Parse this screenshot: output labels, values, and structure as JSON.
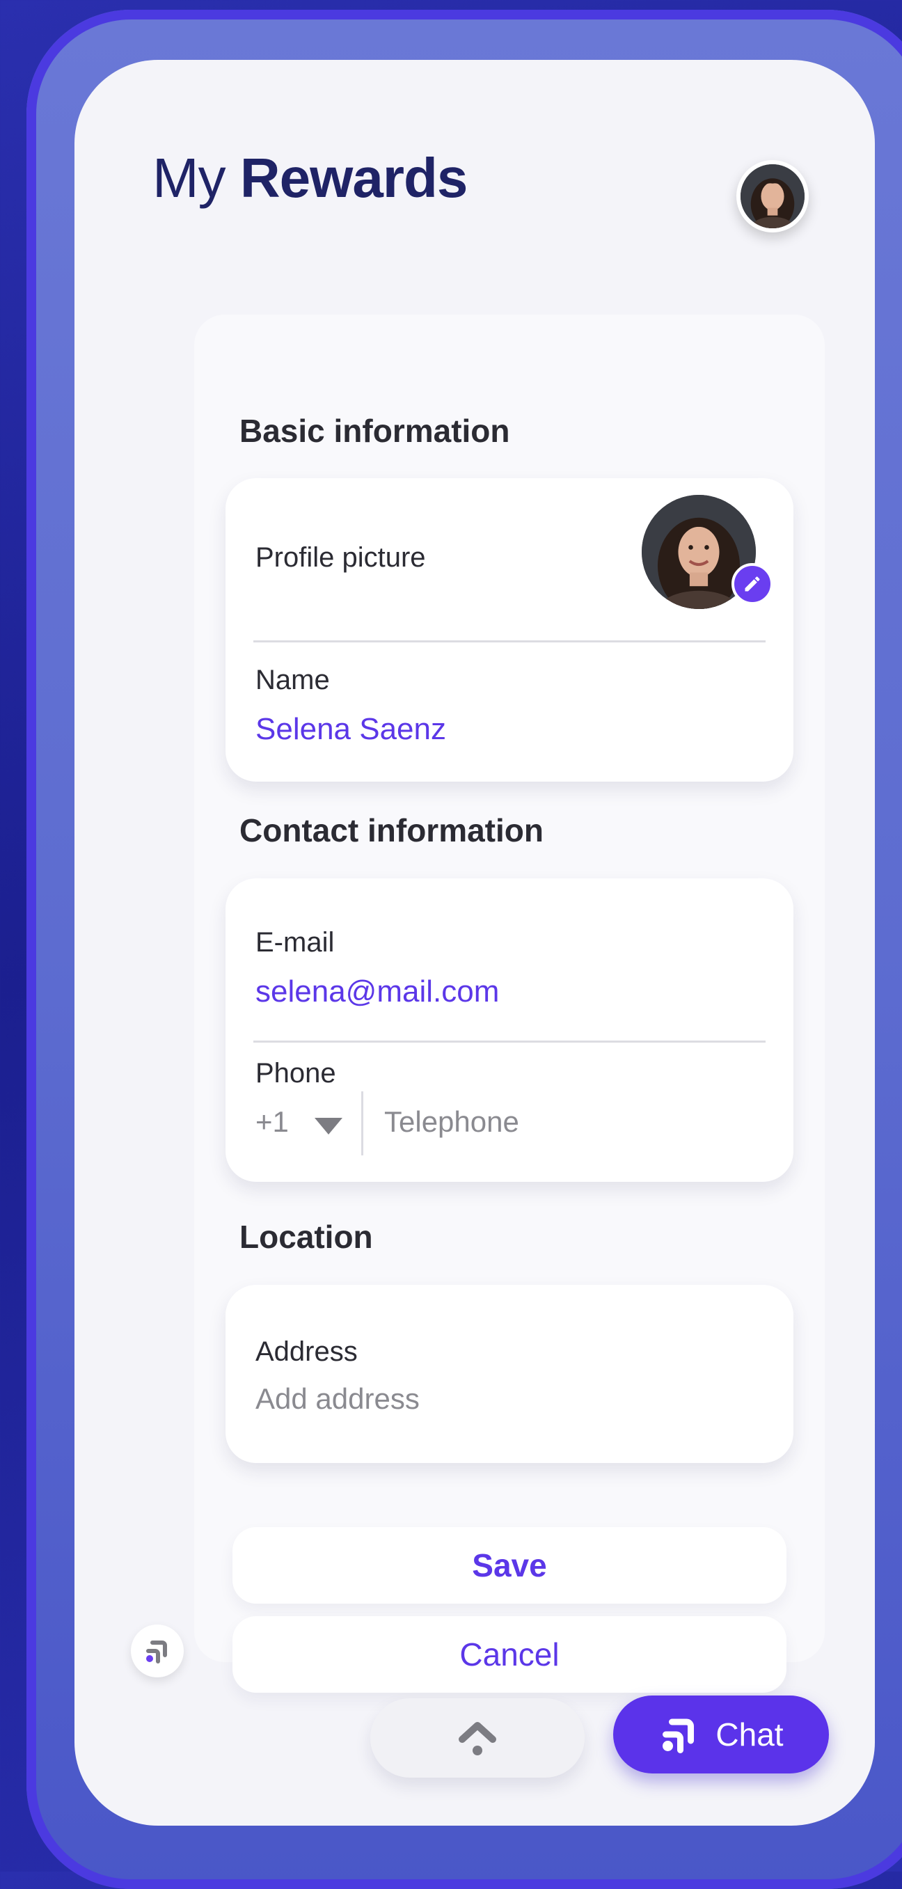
{
  "header": {
    "title_light": "My",
    "title_bold": "Rewards"
  },
  "sections": {
    "basic": {
      "title": "Basic information",
      "profile_picture_label": "Profile picture",
      "name_label": "Name",
      "name_value": "Selena Saenz"
    },
    "contact": {
      "title": "Contact information",
      "email_label": "E-mail",
      "email_value": "selena@mail.com",
      "phone_label": "Phone",
      "country_code": "+1",
      "telephone_placeholder": "Telephone"
    },
    "location": {
      "title": "Location",
      "address_label": "Address",
      "address_placeholder": "Add address"
    }
  },
  "actions": {
    "save_label": "Save",
    "cancel_label": "Cancel"
  },
  "footer": {
    "chat_label": "Chat"
  },
  "colors": {
    "accent": "#5b37e8",
    "title": "#1f2366",
    "background": "#1b1f8f"
  },
  "icons": [
    "pencil-icon",
    "chevron-up-icon",
    "chat-logo-icon",
    "dropdown-triangle-icon"
  ]
}
